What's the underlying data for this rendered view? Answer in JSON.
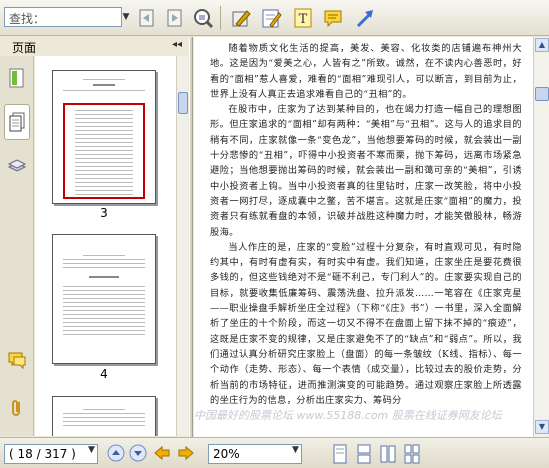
{
  "toolbar": {
    "search_placeholder": "查找：",
    "icons": [
      "page-back-icon",
      "page-forward-icon",
      "zoom-search-icon",
      "highlight-pen-icon",
      "note-pad-icon",
      "text-tool-icon",
      "comment-icon",
      "arrow-tool-icon"
    ]
  },
  "left_panel": {
    "title": "页面",
    "tabs": [
      "pages-icon",
      "bookmark-icon",
      "layers-icon",
      "comments-icon",
      "attachment-icon"
    ],
    "thumbnails": [
      {
        "label": "3"
      },
      {
        "label": "4"
      }
    ]
  },
  "document": {
    "paragraphs": [
      "随着物质文化生活的提高，美发、美容、化妆类的店铺遍布神州大地。这是因为“爱美之心，人皆有之”所致。诚然，在不读内心善恶时，好看的“面相”惹人喜爱，难看的“面相”难现引人，可以断言，到目前为止，世界上没有人真正去追求难看自己的“丑相”的。",
      "在股市中，庄家为了达到某种目的，也在竭力打造一幅自己的理想图形。但庄家追求的“面相”却有两种：“美相”与“丑相”。这与人的追求目的稍有不同，庄家就像一条“变色龙”，当他想要筹码的时候，就会装出一副十分悲惨的“丑相”，吓得中小投资者不寒而栗，抛下筹码，远离市场紧急避险；当他想要抛出筹码的时候，就会装出一副和蔼可亲的“美相”，引诱中小投资者上钩。当中小投资者真的往里钻时，庄家一改笑脸，将中小投资者一网打尽，逐成囊中之鳖，苦不堪言。这就是庄家“面相”的魔力，投资者只有练就看盘的本领，识破并战胜这种魔力时，才能笑傲股林，畅游股海。",
      "当人作庄的是，庄家的“变脸”过程十分复杂，有时直观可见，有时隐约其中，有时有虚有实，有时实中有虚。我们知道，庄家坐庄是要花费很多钱的，但这些钱绝对不是“砸不利己，专门利人”的。庄家要实现自己的目标，就要收集低廉筹码、震荡洗盘、拉升派发……一笔容在《庄家克星——职业操盘手解析坐庄全过程》（下称“《庄》书”）一书里，深入全面解析了坐庄的十个阶段，而这一切又不得不在盘面上留下抹不掉的“痕迹”，这既是庄家不变的规律，又是庄家避免不了的“缺点”和“弱点”。所以，我们通过认真分析研究庄家脸上（盘面）的每一条皱纹（K线、指标）、每一个动作（走势、形态）、每一个表情（成交量），比较过去的股价走势，分析当前的市场特征，进而推测演变的可能趋势。通过观察庄家脸上所透露的坐庄行为的信息，分析出庄家实力、筹码分"
    ],
    "watermark": "中国最好的股票论坛 www.55188.com 股票在线证券网友论坛"
  },
  "bottom_bar": {
    "page_indicator": "( 18 / 317 )",
    "zoom_value": "20%",
    "nav_icons": [
      "first-page-icon",
      "prev-page-icon",
      "next-page-icon",
      "last-page-icon",
      "go-back-icon",
      "go-forward-icon"
    ],
    "view_icons": [
      "single-page-view-icon",
      "continuous-view-icon",
      "facing-view-icon",
      "continuous-facing-view-icon"
    ]
  }
}
